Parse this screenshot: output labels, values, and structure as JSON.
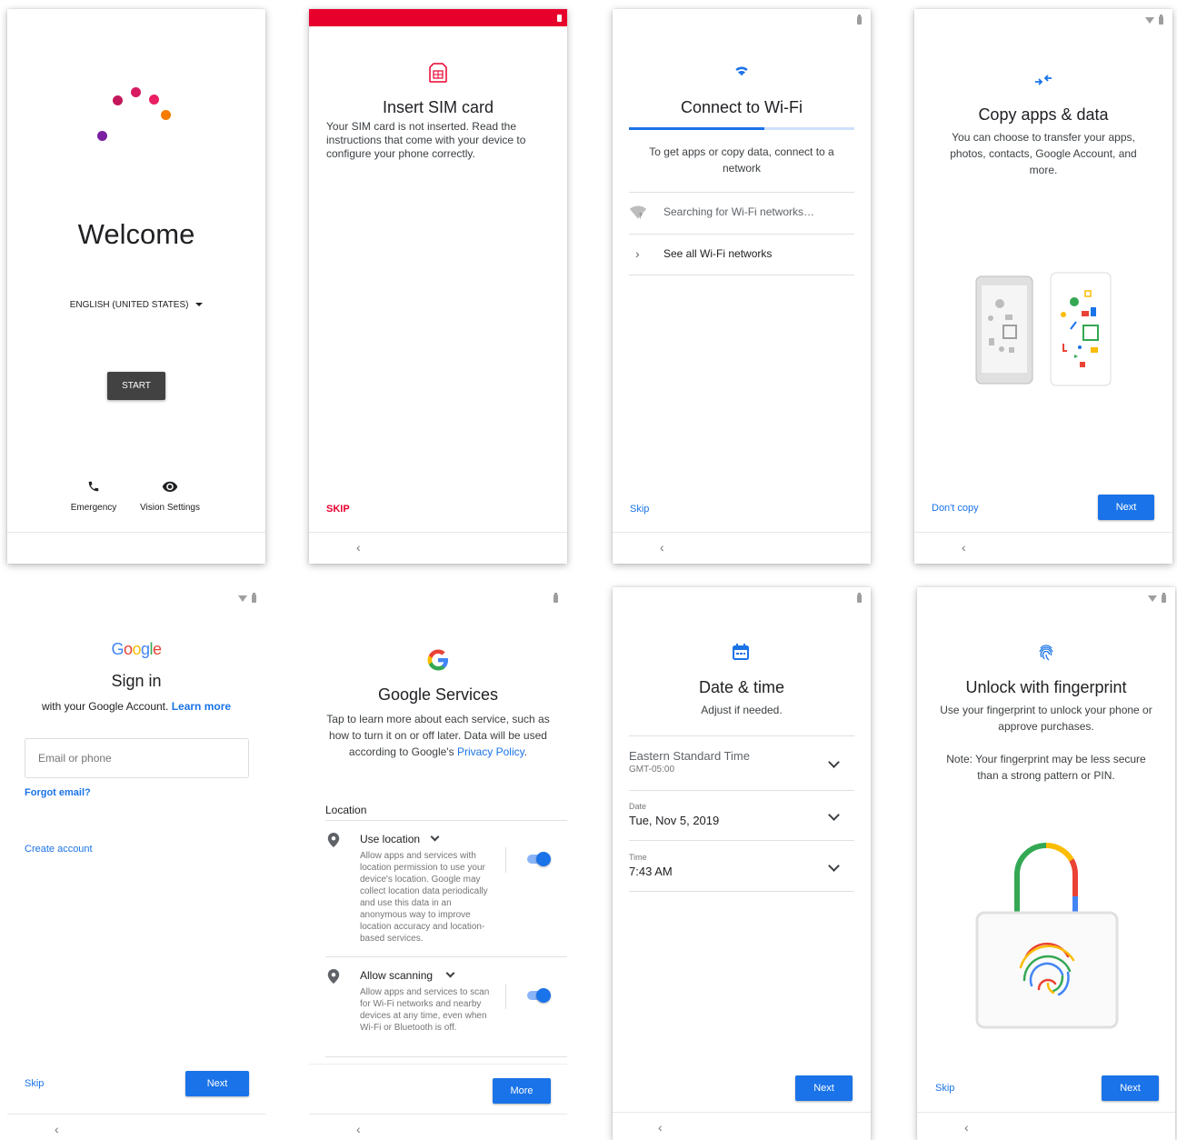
{
  "screens": {
    "welcome": {
      "title": "Welcome",
      "language": "ENGLISH (UNITED STATES)",
      "start_label": "START",
      "emergency_label": "Emergency",
      "vision_label": "Vision Settings"
    },
    "sim": {
      "title": "Insert SIM card",
      "body": "Your SIM card is not inserted. Read the instructions that come with your device to configure your phone correctly.",
      "skip_label": "SKIP",
      "accent_color": "#e8002d"
    },
    "wifi": {
      "title": "Connect to Wi-Fi",
      "body": "To get apps or copy data, connect to a network",
      "searching": "Searching for Wi-Fi networks…",
      "see_all": "See all Wi-Fi networks",
      "skip_label": "Skip"
    },
    "copy": {
      "title": "Copy apps & data",
      "body": "You can choose to transfer your apps, photos, contacts, Google Account, and more.",
      "dont_copy_label": "Don't copy",
      "next_label": "Next"
    },
    "signin": {
      "logo_text": "Google",
      "title": "Sign in",
      "subtitle": "with your Google Account.",
      "learn_more": "Learn more",
      "email_placeholder": "Email or phone",
      "forgot_email": "Forgot email?",
      "create_account": "Create account",
      "skip_label": "Skip",
      "next_label": "Next"
    },
    "services": {
      "title": "Google Services",
      "body_pre": "Tap to learn more about each service, such as how to turn it on or off later. Data will be used according to Google's",
      "privacy_link": "Privacy Policy",
      "body_post": ".",
      "section_label": "Location",
      "use_location_title": "Use location",
      "use_location_desc": "Allow apps and services with location permission to use your device's location. Google may collect location data periodically and use this data in an anonymous way to improve location accuracy and location-based services.",
      "use_location_on": true,
      "scanning_title": "Allow scanning",
      "scanning_desc": "Allow apps and services to scan for Wi-Fi networks and nearby devices at any time, even when Wi-Fi or Bluetooth is off.",
      "scanning_on": true,
      "more_label": "More"
    },
    "datetime": {
      "title": "Date & time",
      "subtitle": "Adjust if needed.",
      "timezone": "Eastern Standard Time",
      "timezone_offset": "GMT-05:00",
      "date_label": "Date",
      "date_value": "Tue, Nov 5, 2019",
      "time_label": "Time",
      "time_value": "7:43 AM",
      "next_label": "Next"
    },
    "fingerprint": {
      "title": "Unlock with fingerprint",
      "body": "Use your fingerprint to unlock your phone or approve purchases.",
      "note": "Note: Your fingerprint may be less secure than a strong pattern or PIN.",
      "skip_label": "Skip",
      "next_label": "Next"
    }
  },
  "colors": {
    "google_blue": "#1a73e8",
    "google_red": "#ea4335",
    "google_yellow": "#fbbc04",
    "google_green": "#34a853"
  }
}
